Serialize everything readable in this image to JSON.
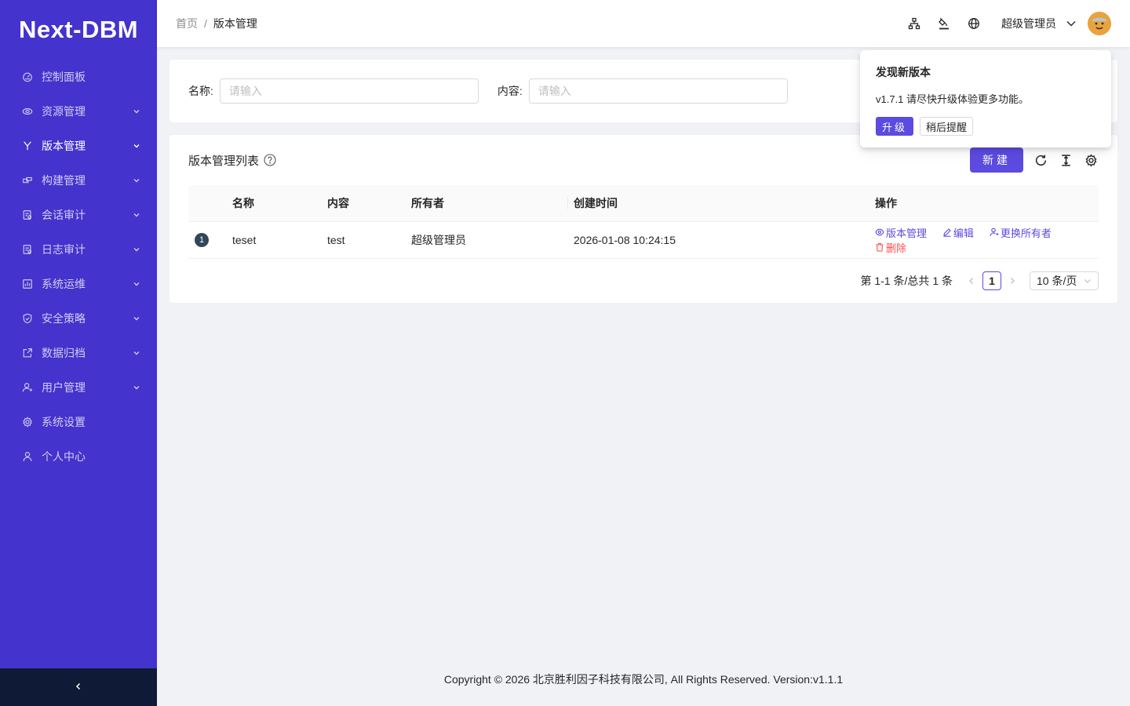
{
  "app": {
    "logo": "Next-DBM"
  },
  "sidebar": {
    "items": [
      {
        "label": "控制面板",
        "icon": "dashboard-icon",
        "has_children": false,
        "active": false
      },
      {
        "label": "资源管理",
        "icon": "cloud-icon",
        "has_children": true,
        "active": false
      },
      {
        "label": "版本管理",
        "icon": "branch-icon",
        "has_children": true,
        "active": true
      },
      {
        "label": "构建管理",
        "icon": "build-icon",
        "has_children": true,
        "active": false
      },
      {
        "label": "会话审计",
        "icon": "audit-icon",
        "has_children": true,
        "active": false
      },
      {
        "label": "日志审计",
        "icon": "log-icon",
        "has_children": true,
        "active": false
      },
      {
        "label": "系统运维",
        "icon": "ops-icon",
        "has_children": true,
        "active": false
      },
      {
        "label": "安全策略",
        "icon": "shield-icon",
        "has_children": true,
        "active": false
      },
      {
        "label": "数据归档",
        "icon": "archive-icon",
        "has_children": true,
        "active": false
      },
      {
        "label": "用户管理",
        "icon": "user-icon",
        "has_children": true,
        "active": false
      },
      {
        "label": "系统设置",
        "icon": "gear-icon",
        "has_children": false,
        "active": false
      },
      {
        "label": "个人中心",
        "icon": "profile-icon",
        "has_children": false,
        "active": false
      }
    ],
    "collapse_glyph": "<"
  },
  "header": {
    "breadcrumb": {
      "home": "首页",
      "separator": "/",
      "current": "版本管理"
    },
    "user_name": "超级管理员"
  },
  "search": {
    "name_label": "名称:",
    "name_placeholder": "请输入",
    "content_label": "内容:",
    "content_placeholder": "请输入"
  },
  "table": {
    "title": "版本管理列表",
    "new_button": "新建",
    "columns": [
      "名称",
      "内容",
      "所有者",
      "创建时间",
      "操作"
    ],
    "rows": [
      {
        "index": "1",
        "name": "teset",
        "content": "test",
        "owner": "超级管理员",
        "created": "2026-01-08 10:24:15",
        "actions": {
          "version": "版本管理",
          "edit": "编辑",
          "change_owner": "更换所有者",
          "delete": "删除"
        }
      }
    ]
  },
  "pagination": {
    "total_text": "第 1-1 条/总共 1 条",
    "current_page": "1",
    "page_size": "10 条/页"
  },
  "popover": {
    "title": "发现新版本",
    "message": "v1.7.1 请尽快升级体验更多功能。",
    "upgrade_button": "升级",
    "later_button": "稍后提醒"
  },
  "footer": {
    "text": "Copyright © 2026 北京胜利因子科技有限公司, All Rights Reserved. Version:v1.1.1"
  },
  "colors": {
    "sidebar_bg": "#4433cc",
    "primary": "#5c4be0",
    "danger": "#ff4d4f",
    "collapse_bg": "#0f1a36"
  }
}
